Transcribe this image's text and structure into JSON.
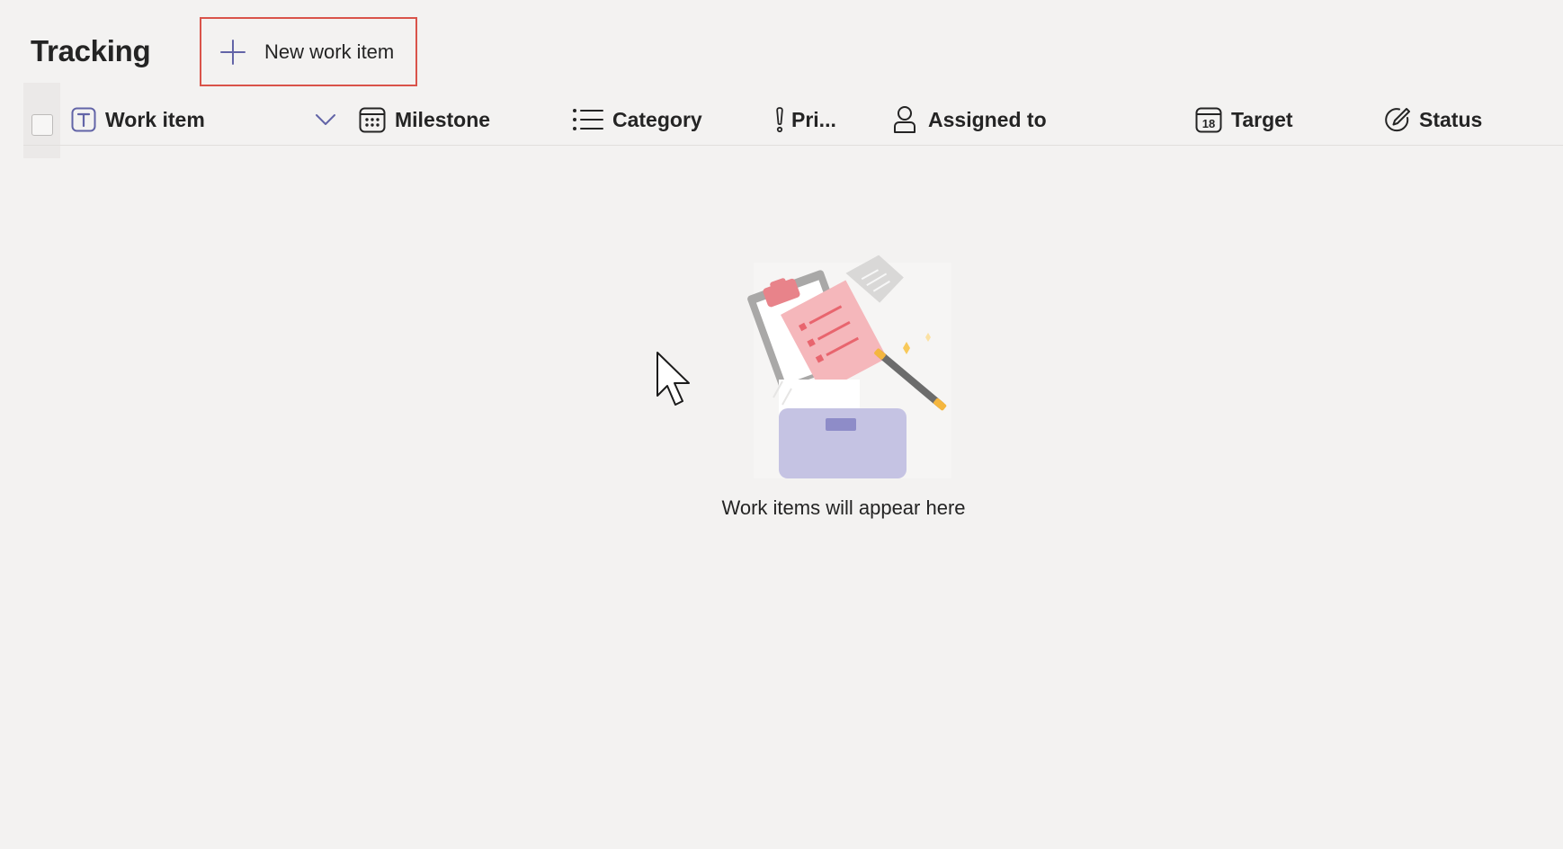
{
  "page": {
    "title": "Tracking"
  },
  "toolbar": {
    "new_item_label": "New work item",
    "new_item_icon": "plus-icon"
  },
  "table": {
    "columns": [
      {
        "label": "Work item",
        "icon": "text-icon"
      },
      {
        "label": "Milestone",
        "icon": "calendar-icon"
      },
      {
        "label": "Category",
        "icon": "list-icon"
      },
      {
        "label": "Pri...",
        "icon": "exclamation-icon"
      },
      {
        "label": "Assigned to",
        "icon": "person-icon"
      },
      {
        "label": "Target",
        "icon": "calendar-date-icon"
      },
      {
        "label": "Status",
        "icon": "pen-circle-icon"
      }
    ],
    "target_icon_number": "18"
  },
  "empty_state": {
    "message": "Work items will appear here"
  },
  "colors": {
    "background": "#f3f2f1",
    "accent": "#6264a7",
    "highlight_box": "#d9534a"
  }
}
